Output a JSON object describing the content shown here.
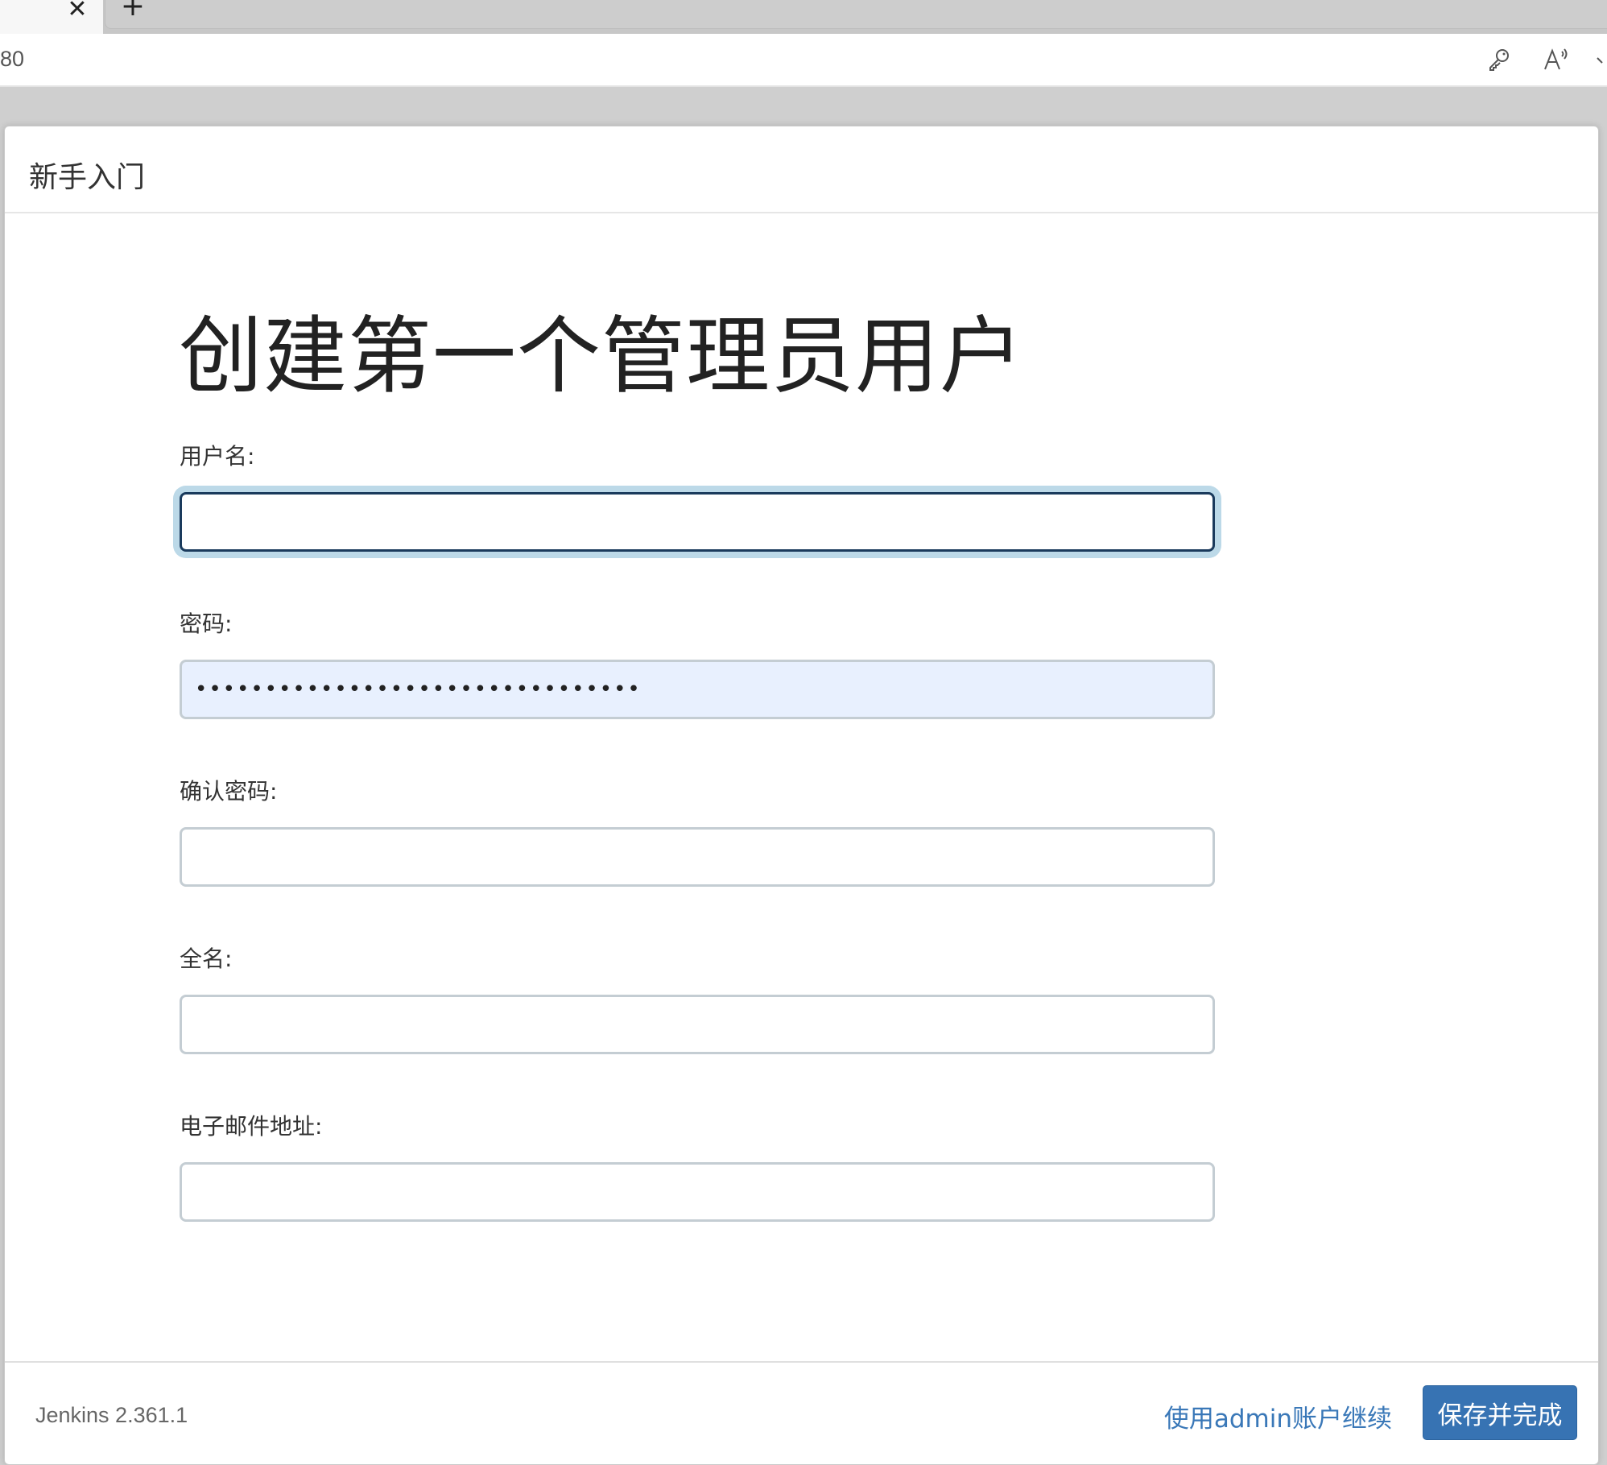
{
  "browser": {
    "url_fragment": "80",
    "close_glyph": "✕",
    "newtab_glyph": "+",
    "icons": [
      "key-icon",
      "read-aloud-icon"
    ]
  },
  "dialog": {
    "header_title": "新手入门",
    "heading": "创建第一个管理员用户",
    "fields": {
      "username": {
        "label": "用户名:",
        "value": ""
      },
      "password": {
        "label": "密码:",
        "value": "••••••••••••••••••••••••••••••••"
      },
      "confirm_password": {
        "label": "确认密码:",
        "value": ""
      },
      "fullname": {
        "label": "全名:",
        "value": ""
      },
      "email": {
        "label": "电子邮件地址:",
        "value": ""
      }
    },
    "footer": {
      "version": "Jenkins 2.361.1",
      "continue_link": "使用admin账户继续",
      "save_button": "保存并完成"
    }
  },
  "colors": {
    "primary_button": "#3773b3",
    "link": "#3a78b8",
    "focus_border": "#1a3a5c",
    "autofill_bg": "#e8f0fe"
  }
}
